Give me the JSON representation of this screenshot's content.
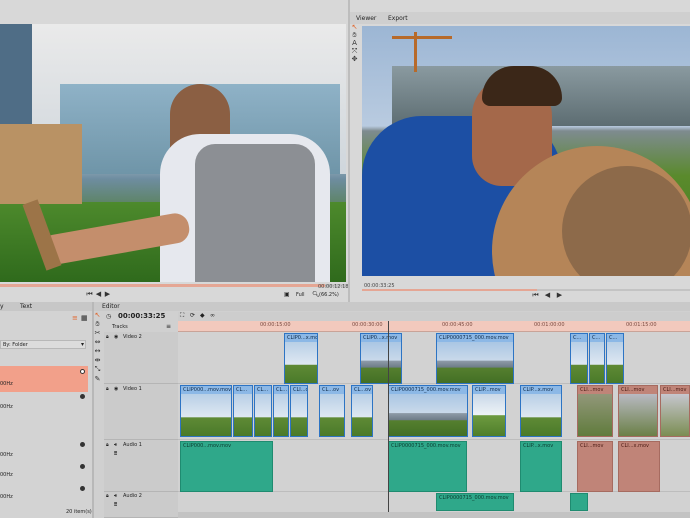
{
  "viewer_left": {
    "timecode": "00:00:12:18",
    "zoom_mode": "Full",
    "zoom_level": "(66.2%)"
  },
  "viewer_right": {
    "tabs": [
      "Viewer",
      "Export"
    ],
    "timecode": "00:00:33:25"
  },
  "media_panel": {
    "tabs": [
      "y",
      "Text"
    ],
    "sort_label": "By: Folder",
    "rows": [
      "00Hz",
      "00Hz",
      "00Hz",
      "00Hz",
      "00Hz"
    ],
    "item_count": "20 item(s)"
  },
  "editor": {
    "tab": "Editor",
    "timecode": "00:00:33:25",
    "tracks_label": "Tracks",
    "track_names": [
      "Video 2",
      "Video 1",
      "Audio 1",
      "Audio 2"
    ],
    "ruler_labels": [
      "00:00:15:00",
      "00:00:30:00",
      "00:00:45:00",
      "00:01:00:00",
      "00:01:15:00"
    ],
    "video2_clips": [
      "CLIP0...x.mov",
      "CLIP0...x.mov",
      "CLIP0000715_000.mov.mov",
      "C...",
      "C...",
      "C..."
    ],
    "video1_clips": [
      "CLIP000...mov.mov",
      "CL...",
      "CL...",
      "CL...",
      "CLI...ov",
      "CL...ov",
      "CLIP0000715_000.mov.mov",
      "CLIP...mov",
      "CLIP...x.mov",
      "CLI...mov",
      "CLI...mov",
      "CLI...mov"
    ],
    "audio1_clips": [
      "CLIP000...mov.mov",
      "CLIP0000715_000.mov.mov",
      "CLIP...x.mov",
      "CLI...mov",
      "CLI...x.mov"
    ],
    "audio2_clips": [
      "CLIP0000715_000.mov.mov"
    ]
  },
  "colors": {
    "video_clip": "#7fb0e0",
    "audio_clip": "#2fa88a",
    "disabled_clip": "#c08478",
    "ruler": "#f2c9bd",
    "selection": "#f2a08a"
  }
}
